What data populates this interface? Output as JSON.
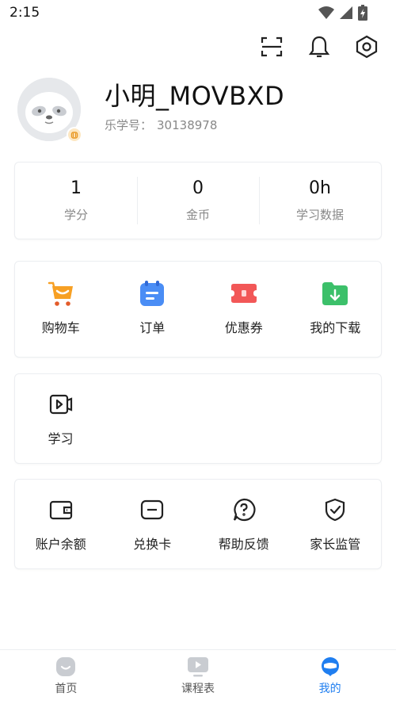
{
  "status_bar": {
    "time": "2:15"
  },
  "profile": {
    "username": "小明_MOVBXD",
    "id_label": "乐学号：",
    "id_value": "30138978"
  },
  "stats": [
    {
      "value": "1",
      "label": "学分"
    },
    {
      "value": "0",
      "label": "金币"
    },
    {
      "value": "0h",
      "label": "学习数据"
    }
  ],
  "shop": [
    {
      "label": "购物车",
      "icon": "shopping-cart-icon"
    },
    {
      "label": "订单",
      "icon": "order-icon"
    },
    {
      "label": "优惠券",
      "icon": "coupon-icon"
    },
    {
      "label": "我的下载",
      "icon": "download-folder-icon"
    }
  ],
  "study": [
    {
      "label": "学习",
      "icon": "video-play-icon"
    }
  ],
  "tools": [
    {
      "label": "账户余额",
      "icon": "wallet-icon"
    },
    {
      "label": "兑换卡",
      "icon": "card-icon"
    },
    {
      "label": "帮助反馈",
      "icon": "help-icon"
    },
    {
      "label": "家长监管",
      "icon": "shield-icon"
    }
  ],
  "bottom_nav": [
    {
      "label": "首页",
      "icon": "home-icon",
      "active": false
    },
    {
      "label": "课程表",
      "icon": "schedule-icon",
      "active": false
    },
    {
      "label": "我的",
      "icon": "profile-icon",
      "active": true
    }
  ],
  "colors": {
    "accent": "#1f7ef0",
    "cart": "#f7a024",
    "order": "#3b82f6",
    "coupon": "#f25757",
    "download": "#3cc06a"
  }
}
